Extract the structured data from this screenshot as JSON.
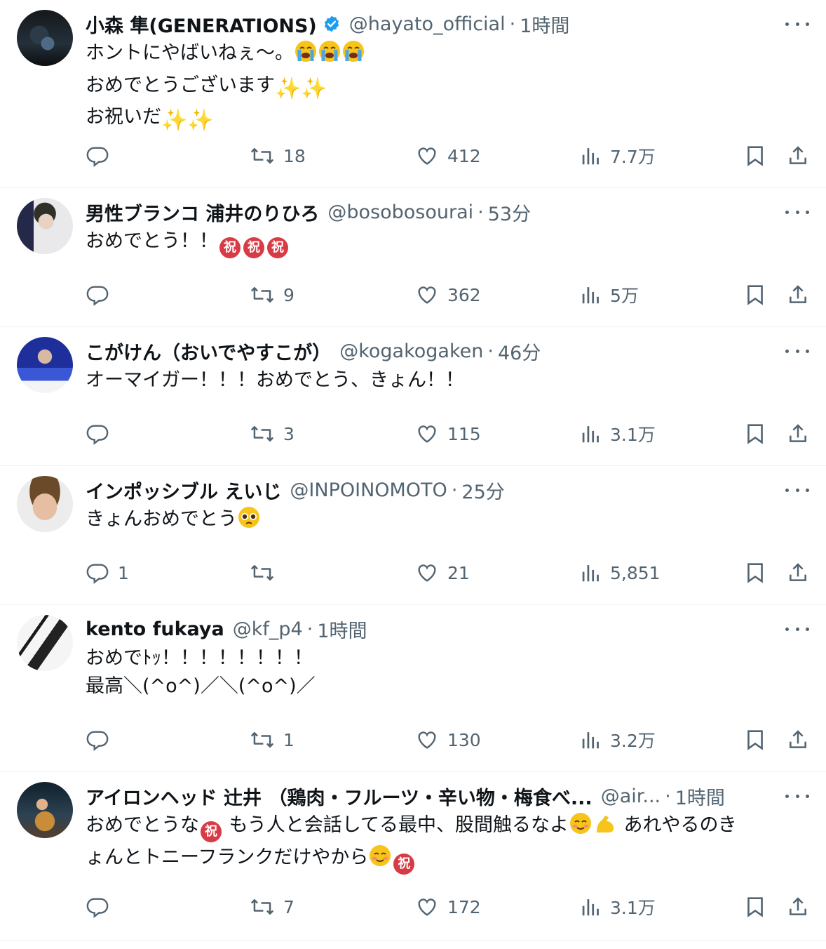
{
  "tweets": [
    {
      "name": "小森 隼(GENERATIONS)",
      "verified": true,
      "handle": "@hayato_official",
      "time": "1時間",
      "lines": [
        "ホントにやばいねぇ〜。",
        "おめでとうございます",
        "お祝いだ"
      ],
      "stats": {
        "reply": "",
        "retweet": "18",
        "like": "412",
        "views": "7.7万"
      }
    },
    {
      "name": "男性ブランコ 浦井のりひろ",
      "verified": false,
      "handle": "@bosobosourai",
      "time": "53分",
      "lines": [
        "おめでとう！！"
      ],
      "stats": {
        "reply": "",
        "retweet": "9",
        "like": "362",
        "views": "5万"
      }
    },
    {
      "name": "こがけん（おいでやすこが）",
      "verified": false,
      "handle": "@kogakogaken",
      "time": "46分",
      "lines": [
        "オーマイガー！！！おめでとう、きょん！！"
      ],
      "stats": {
        "reply": "",
        "retweet": "3",
        "like": "115",
        "views": "3.1万"
      }
    },
    {
      "name": "インポッシブル えいじ",
      "verified": false,
      "handle": "@INPOINOMOTO",
      "time": "25分",
      "lines": [
        "きょんおめでとう"
      ],
      "stats": {
        "reply": "1",
        "retweet": "",
        "like": "21",
        "views": "5,851"
      }
    },
    {
      "name": "kento fukaya",
      "verified": false,
      "handle": "@kf_p4",
      "time": "1時間",
      "lines": [
        "おめでﾄｯ！！！！！！！！",
        "最高＼(^o^)／＼(^o^)／"
      ],
      "stats": {
        "reply": "",
        "retweet": "1",
        "like": "130",
        "views": "3.2万"
      }
    },
    {
      "name": "アイロンヘッド 辻井 （鶏肉・フルーツ・辛い物・梅食べ...",
      "verified": false,
      "handle": "@air...",
      "time": "1時間",
      "lines": [
        "おめでとうな",
        " もう人と会話してる最中、股間触るなよ",
        " あれやるのき",
        "ょんとトニーフランクだけやから"
      ],
      "stats": {
        "reply": "",
        "retweet": "7",
        "like": "172",
        "views": "3.1万"
      }
    }
  ],
  "emoji": {
    "iwai": "祝",
    "sparkles": "✨",
    "crying": "loudly-crying-face",
    "pleading": "pleading-face",
    "blush": "smiling-face-with-blush",
    "flexed": "flexed-biceps"
  },
  "separators": {
    "dot": "·"
  },
  "colors": {
    "text": "#0f1419",
    "muted": "#536471",
    "border": "#eff3f4",
    "verified": "#1d9bf0",
    "iwai": "#d73b45"
  }
}
